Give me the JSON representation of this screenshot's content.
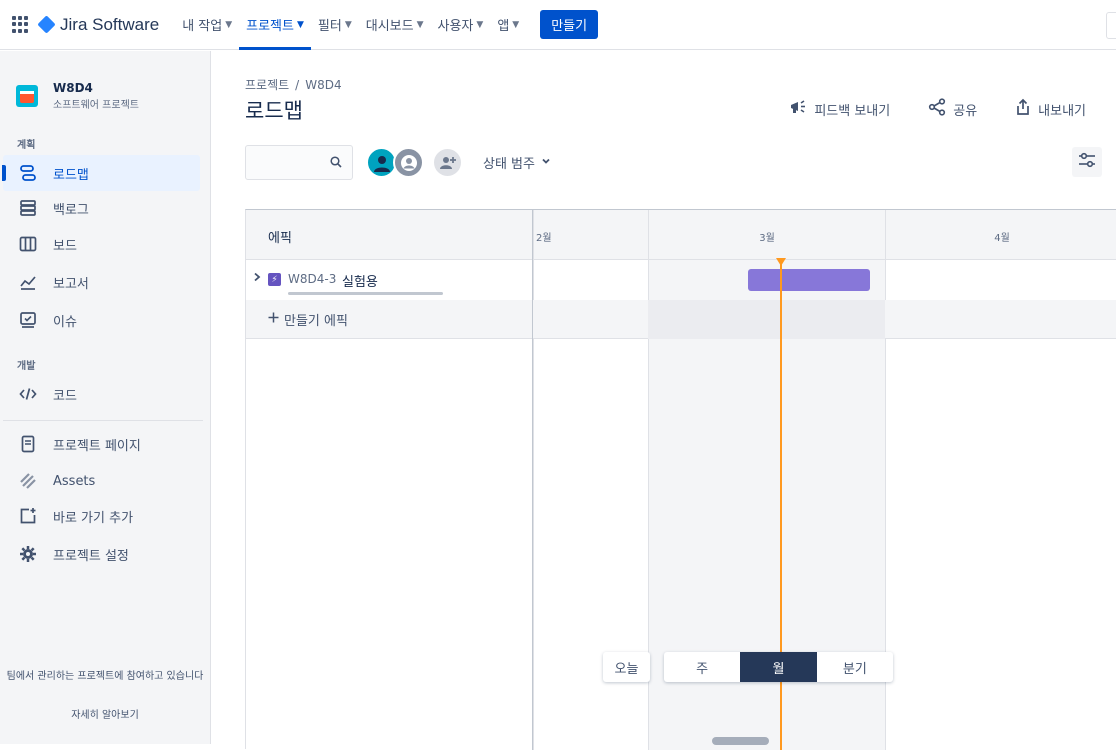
{
  "topbar": {
    "product": "Jira Software",
    "nav": [
      {
        "label": "내 작업"
      },
      {
        "label": "프로젝트"
      },
      {
        "label": "필터"
      },
      {
        "label": "대시보드"
      },
      {
        "label": "사용자"
      },
      {
        "label": "앱"
      }
    ],
    "create_label": "만들기"
  },
  "sidebar": {
    "project_name": "W8D4",
    "project_type": "소프트웨어 프로젝트",
    "section_plan": "계획",
    "section_dev": "개발",
    "items": [
      {
        "label": "로드맵",
        "icon": "roadmap-icon"
      },
      {
        "label": "백로그",
        "icon": "backlog-icon"
      },
      {
        "label": "보드",
        "icon": "board-icon"
      },
      {
        "label": "보고서",
        "icon": "reports-icon"
      },
      {
        "label": "이슈",
        "icon": "issues-icon"
      },
      {
        "label": "코드",
        "icon": "code-icon"
      },
      {
        "label": "프로젝트 페이지",
        "icon": "page-icon"
      },
      {
        "label": "Assets",
        "icon": "assets-icon"
      },
      {
        "label": "바로 가기 추가",
        "icon": "add-shortcut-icon"
      },
      {
        "label": "프로젝트 설정",
        "icon": "settings-icon"
      }
    ],
    "footer_text": "팀에서 관리하는 프로젝트에 참여하고 있습니다",
    "footer_link": "자세히 알아보기"
  },
  "main": {
    "breadcrumb_root": "프로젝트",
    "breadcrumb_sep": "/",
    "breadcrumb_project": "W8D4",
    "title": "로드맵",
    "actions": {
      "feedback": "피드백 보내기",
      "share": "공유",
      "export": "내보내기"
    },
    "status_filter": "상태 범주",
    "epic_column": "에픽",
    "months": [
      "2월",
      "3월",
      "4월"
    ],
    "epics": [
      {
        "key": "W8D4-3",
        "title": "실험용"
      }
    ],
    "add_epic": "만들기 에픽",
    "today_label": "오늘",
    "zoom_levels": [
      "주",
      "월",
      "분기"
    ],
    "zoom_selected": "월"
  },
  "colors": {
    "brand": "#0052cc",
    "epic": "#6554c0",
    "epic_bar": "#8777d9",
    "today_line": "#ff991f",
    "selected_zoom": "#253858"
  }
}
